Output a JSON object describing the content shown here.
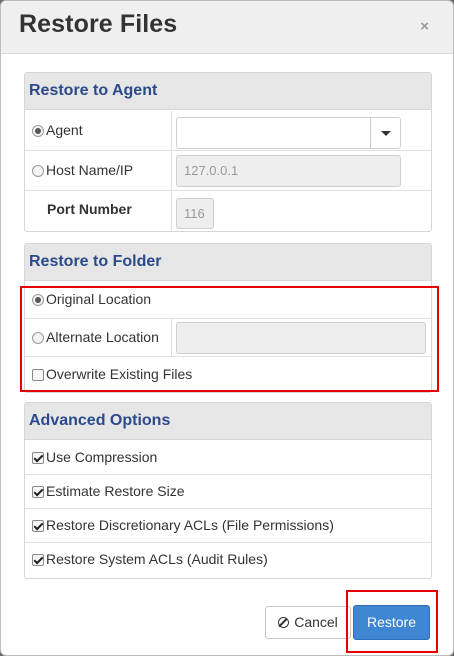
{
  "dialog": {
    "title": "Restore Files",
    "close_label": "×"
  },
  "restore_to_agent": {
    "heading": "Restore to Agent",
    "agent_option": {
      "label": "Agent",
      "selected": true,
      "value": ""
    },
    "host_option": {
      "label": "Host Name/IP",
      "selected": false,
      "placeholder": "127.0.0.1"
    },
    "port": {
      "label": "Port Number",
      "placeholder": "116"
    }
  },
  "restore_to_folder": {
    "heading": "Restore to Folder",
    "original": {
      "label": "Original Location",
      "selected": true
    },
    "alternate": {
      "label": "Alternate Location",
      "selected": false,
      "value": ""
    },
    "overwrite": {
      "label": "Overwrite Existing Files",
      "checked": false
    }
  },
  "advanced_options": {
    "heading": "Advanced Options",
    "items": [
      {
        "label": "Use Compression",
        "checked": true
      },
      {
        "label": "Estimate Restore Size",
        "checked": true
      },
      {
        "label": "Restore Discretionary ACLs (File Permissions)",
        "checked": true
      },
      {
        "label": "Restore System ACLs (Audit Rules)",
        "checked": true
      }
    ]
  },
  "footer": {
    "cancel_label": "Cancel",
    "cancel_icon": "ban-icon",
    "restore_label": "Restore"
  },
  "colors": {
    "heading_text": "#2b4a8c",
    "primary_button": "#3f86d3",
    "highlight_box": "#e60000"
  }
}
